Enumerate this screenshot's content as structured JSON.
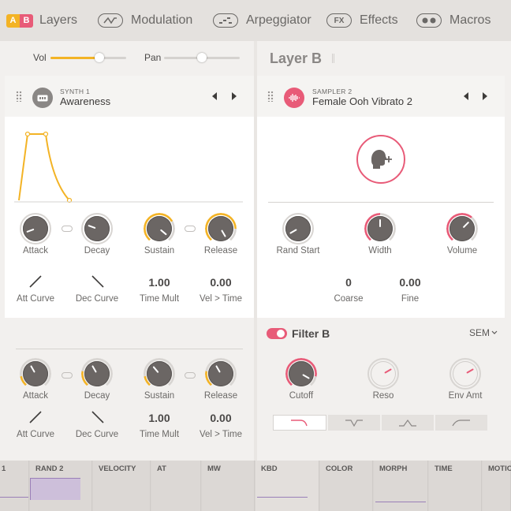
{
  "nav": {
    "ab_a": "A",
    "ab_b": "B",
    "layers": "Layers",
    "modulation": "Modulation",
    "arpeggiator": "Arpeggiator",
    "effects_icon": "FX",
    "effects": "Effects",
    "macros": "Macros"
  },
  "mixer": {
    "vol_label": "Vol",
    "pan_label": "Pan",
    "vol_value": 0.65,
    "pan_value": 0.5
  },
  "layer_a": {
    "engine_type": "SYNTH 1",
    "engine_name": "Awareness",
    "env1": {
      "knobs": [
        {
          "label": "Attack"
        },
        {
          "label": "Decay"
        },
        {
          "label": "Sustain"
        },
        {
          "label": "Release"
        }
      ],
      "curves": [
        {
          "label": "Att Curve"
        },
        {
          "label": "Dec Curve"
        },
        {
          "value": "1.00",
          "label": "Time Mult"
        },
        {
          "value": "0.00",
          "label": "Vel > Time"
        }
      ]
    },
    "env2": {
      "knobs": [
        {
          "label": "Attack"
        },
        {
          "label": "Decay"
        },
        {
          "label": "Sustain"
        },
        {
          "label": "Release"
        }
      ],
      "curves": [
        {
          "label": "Att Curve"
        },
        {
          "label": "Dec Curve"
        },
        {
          "value": "1.00",
          "label": "Time Mult"
        },
        {
          "value": "0.00",
          "label": "Vel > Time"
        }
      ]
    }
  },
  "layer_b": {
    "title": "Layer B",
    "engine_type": "SAMPLER 2",
    "engine_name": "Female Ooh Vibrato 2",
    "knobs": [
      {
        "label": "Rand Start"
      },
      {
        "label": "Width"
      },
      {
        "label": "Volume"
      }
    ],
    "values": [
      {
        "value": "0",
        "label": "Coarse"
      },
      {
        "value": "0.00",
        "label": "Fine"
      }
    ]
  },
  "filter_b": {
    "title": "Filter B",
    "type": "SEM",
    "knobs": [
      {
        "label": "Cutoff"
      },
      {
        "label": "Reso"
      },
      {
        "label": "Env Amt"
      }
    ]
  },
  "mod_sources": [
    "1",
    "RAND 2",
    "VELOCITY",
    "AT",
    "MW",
    "KBD",
    "COLOR",
    "MORPH",
    "TIME",
    "MOTIO"
  ],
  "colors": {
    "accent": "#f3b325",
    "layer_b": "#e85b78"
  }
}
